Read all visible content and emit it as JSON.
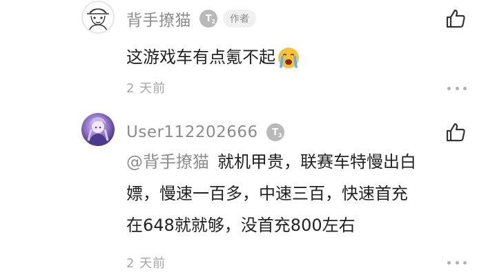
{
  "comments": [
    {
      "username": "背手撩猫",
      "level": "T",
      "level_sub": "2",
      "author_tag": "作者",
      "text": "这游戏车有点氪不起",
      "emoji": "crying-face",
      "time": "2 天前",
      "icons": {
        "like": "thumbs-up-icon",
        "more": "more-dots-icon"
      }
    },
    {
      "username": "User112202666",
      "level": "T",
      "level_sub": "3",
      "mention": "@背手撩猫",
      "text_lines": [
        "就机甲贵，联赛车特慢出白",
        "嫖，慢速一百多，中速三百，快速首充",
        "在648就就够，没首充800左右"
      ],
      "time": "2 天前",
      "icons": {
        "like": "thumbs-up-icon",
        "more": "more-dots-icon"
      }
    }
  ],
  "colors": {
    "username": "#8c8c8c",
    "text": "#222222",
    "meta": "#a6a6a6",
    "badge": "#b9b9b9"
  }
}
